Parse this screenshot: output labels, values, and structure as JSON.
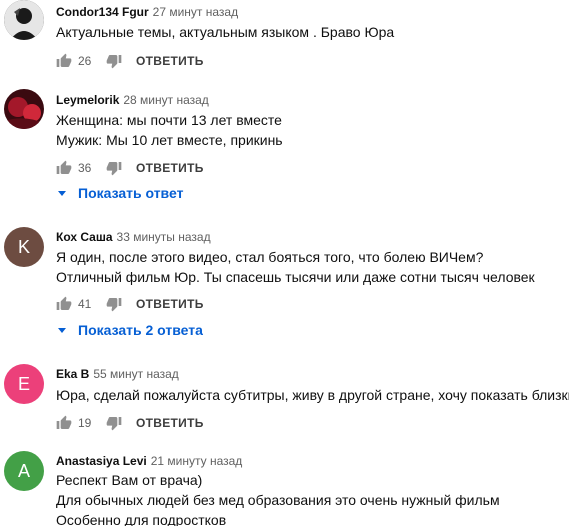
{
  "comments": [
    {
      "author": "Condor134 Fgur",
      "time": "27 минут назад",
      "lines": [
        "Актуальные темы, актуальным языком . Браво Юра"
      ],
      "likes": "26",
      "reply_label": "ОТВЕТИТЬ",
      "avatar": {
        "type": "photo",
        "color": "#2a2a2a"
      }
    },
    {
      "author": "Leymelorik",
      "time": "28 минут назад",
      "lines": [
        "Женщина: мы почти 13 лет вместе",
        "Мужик: Мы 10 лет вместе, прикинь"
      ],
      "likes": "36",
      "reply_label": "ОТВЕТИТЬ",
      "show_replies": "Показать ответ",
      "avatar": {
        "type": "photo",
        "color": "#8a1a22"
      }
    },
    {
      "author": "Кох Саша",
      "time": "33 минуты назад",
      "lines": [
        "Я один, после этого видео, стал бояться того, что болею ВИЧем?",
        "Отличный фильм Юр. Ты спасешь тысячи или даже сотни тысяч человек"
      ],
      "likes": "41",
      "reply_label": "ОТВЕТИТЬ",
      "show_replies": "Показать 2 ответа",
      "avatar": {
        "type": "letter",
        "letter": "K",
        "color": "#6d4c41"
      }
    },
    {
      "author": "Eka B",
      "time": "55 минут назад",
      "lines": [
        "Юра, сделай пожалуйста субтитры, живу в другой стране, хочу показать близким"
      ],
      "likes": "19",
      "reply_label": "ОТВЕТИТЬ",
      "avatar": {
        "type": "letter",
        "letter": "E",
        "color": "#ec407a"
      }
    },
    {
      "author": "Anastasiya Levi",
      "time": "21 минуту назад",
      "lines": [
        "Респект Вам от врача)",
        "Для обычных людей без мед образования это очень нужный фильм",
        "Особенно для подростков"
      ],
      "avatar": {
        "type": "letter",
        "letter": "A",
        "color": "#43a047"
      }
    }
  ],
  "icons": {
    "like": "thumb-up-icon",
    "dislike": "thumb-down-icon",
    "expand": "caret-down-icon"
  },
  "colors": {
    "link": "#065fd4",
    "secondary_text": "#606060"
  }
}
